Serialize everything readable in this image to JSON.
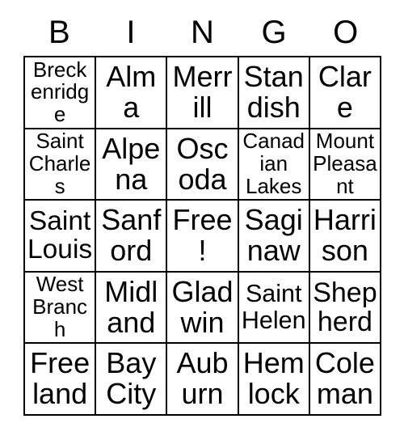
{
  "card": {
    "title": "BINGO",
    "headers": [
      "B",
      "I",
      "N",
      "G",
      "O"
    ],
    "free_space_label": "Free!",
    "colors": {
      "border": "#000000",
      "background": "#ffffff",
      "text": "#000000"
    },
    "rows": [
      [
        {
          "label": "Breckenridge",
          "free": false
        },
        {
          "label": "Alma",
          "free": false
        },
        {
          "label": "Merrill",
          "free": false
        },
        {
          "label": "Standish",
          "free": false
        },
        {
          "label": "Clare",
          "free": false
        }
      ],
      [
        {
          "label": "Saint Charles",
          "free": false
        },
        {
          "label": "Alpena",
          "free": false
        },
        {
          "label": "Oscoda",
          "free": false
        },
        {
          "label": "Canadian Lakes",
          "free": false
        },
        {
          "label": "Mount Pleasant",
          "free": false
        }
      ],
      [
        {
          "label": "Saint Louis",
          "free": false
        },
        {
          "label": "Sanford",
          "free": false
        },
        {
          "label": "Free!",
          "free": true
        },
        {
          "label": "Saginaw",
          "free": false
        },
        {
          "label": "Harrison",
          "free": false
        }
      ],
      [
        {
          "label": "West Branch",
          "free": false
        },
        {
          "label": "Midland",
          "free": false
        },
        {
          "label": "Gladwin",
          "free": false
        },
        {
          "label": "Saint Helen",
          "free": false
        },
        {
          "label": "Shepherd",
          "free": false
        }
      ],
      [
        {
          "label": "Freeland",
          "free": false
        },
        {
          "label": "Bay City",
          "free": false
        },
        {
          "label": "Auburn",
          "free": false
        },
        {
          "label": "Hemlock",
          "free": false
        },
        {
          "label": "Coleman",
          "free": false
        }
      ]
    ]
  }
}
